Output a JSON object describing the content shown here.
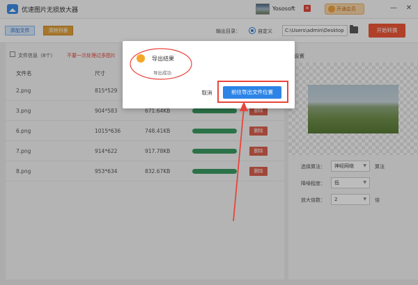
{
  "window": {
    "title": "优速图片无损放大器",
    "username": "Yososoft",
    "member_label": "开通会员",
    "minimize": "—",
    "close": "✕"
  },
  "toolbar": {
    "add_files": "添加文件",
    "clear_list": "清除列表",
    "output_dir_label": "输出目录：",
    "custom_label": "自定义",
    "output_path": "C:\\Users\\admin\\Desktop",
    "start_label": "开始转换"
  },
  "file_panel": {
    "info_text": "文件信息（8个）",
    "warn_text": "不要一次处理过多图片",
    "columns": {
      "name": "文件名",
      "size": "尺寸"
    },
    "delete_label": "删除",
    "files": [
      {
        "name": "2.png",
        "dimensions": "815*529",
        "filesize": "",
        "progress": 1.0
      },
      {
        "name": "3.png",
        "dimensions": "904*583",
        "filesize": "671.64KB",
        "progress": 1.0
      },
      {
        "name": "6.png",
        "dimensions": "1015*636",
        "filesize": "748.41KB",
        "progress": 1.0
      },
      {
        "name": "7.png",
        "dimensions": "914*622",
        "filesize": "917.78KB",
        "progress": 1.0
      },
      {
        "name": "8.png",
        "dimensions": "953*634",
        "filesize": "832.67KB",
        "progress": 1.0
      }
    ]
  },
  "settings": {
    "header": "设置",
    "algorithm_label": "选择算法：",
    "algorithm_value": "神经网络",
    "algorithm_suffix": "算法",
    "noise_label": "降噪程度：",
    "noise_value": "低",
    "scale_label": "放大倍数：",
    "scale_value": "2",
    "scale_suffix": "倍"
  },
  "dialog": {
    "title": "导出结果",
    "message": "导出成功",
    "cancel_label": "取消",
    "goto_label": "前往导出文件位置"
  },
  "colors": {
    "accent_blue": "#2e84e6",
    "start_button": "#ee5737",
    "progress_green": "#3c9a62",
    "delete_red": "#d9614d",
    "annotation_red": "#e8443a"
  }
}
